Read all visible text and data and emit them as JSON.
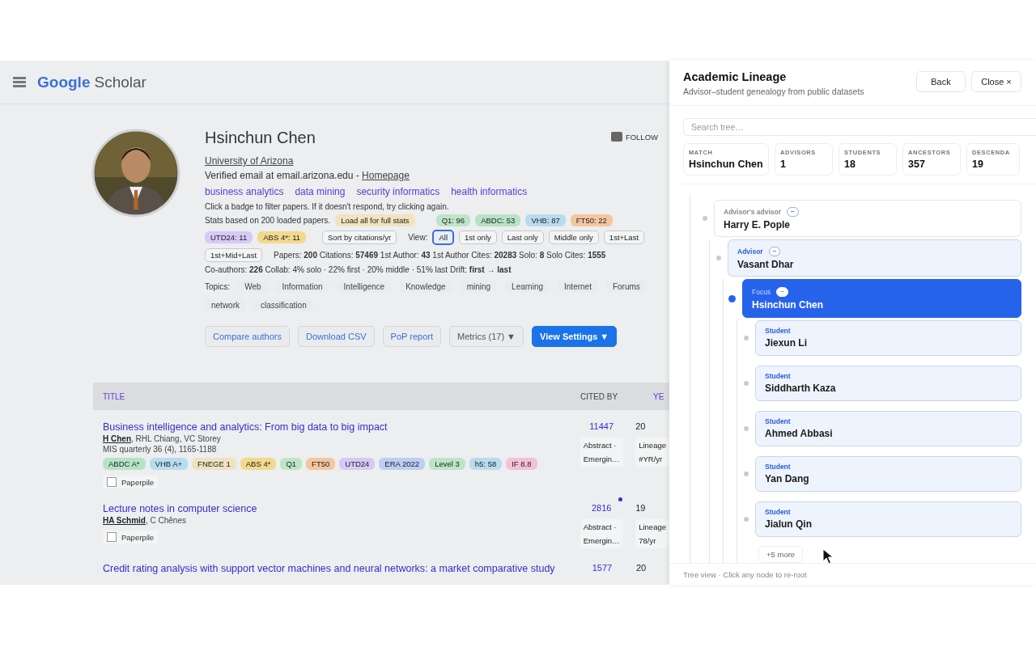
{
  "background_page": {
    "logo": {
      "first": "Google",
      "second": "Scholar"
    },
    "profile": {
      "name": "Hsinchun Chen",
      "affiliation": "University of Arizona",
      "email": "Verified email at email.arizona.edu - ",
      "homepage": "Homepage",
      "follow": "FOLLOW",
      "interests": [
        "business analytics",
        "data mining",
        "security informatics",
        "health informatics"
      ],
      "hint": "Click a badge to filter papers. If it doesn't respond, try clicking again.",
      "stats_note": "Stats based on 200 loaded papers.",
      "load_all": "Load all for full stats",
      "rank_badges": [
        {
          "label": "Q1: 96",
          "color": "#bde5c5"
        },
        {
          "label": "ABDC: 53",
          "color": "#b5e3c6"
        },
        {
          "label": "VHB: 87",
          "color": "#b8dcef"
        },
        {
          "label": "FT50: 22",
          "color": "#f4c6a0"
        },
        {
          "label": "UTD24: 11",
          "color": "#d7c9f6"
        },
        {
          "label": "ABS 4*: 11",
          "color": "#f3d98c"
        }
      ],
      "sort": "Sort by citations/yr",
      "view_label": "View:",
      "views": [
        {
          "label": "All",
          "selected": true
        },
        {
          "label": "1st only",
          "selected": false
        },
        {
          "label": "Last only",
          "selected": false
        },
        {
          "label": "Middle only",
          "selected": false
        },
        {
          "label": "1st+Last",
          "selected": false
        },
        {
          "label": "1st+Mid+Last",
          "selected": false
        }
      ],
      "metrics_line": "Papers: **200** Citations: **57469** 1st Author: **43** 1st Author Cites: **20283** Solo: **8** Solo Cites: **1555**",
      "coauthors_line": "Co-authors: **226** Collab: 4% solo · 22% first · 20% middle · 51% last Drift: **first → last**",
      "topics_label": "Topics:",
      "topics": [
        "Web",
        "Information",
        "Intelligence",
        "Knowledge",
        "mining",
        "Learning",
        "Internet",
        "Forums",
        "network",
        "classification"
      ],
      "actions": [
        {
          "label": "Compare authors",
          "kind": "outline"
        },
        {
          "label": "Download CSV",
          "kind": "outline"
        },
        {
          "label": "PoP report",
          "kind": "outline"
        },
        {
          "label": "Metrics (17) ▼",
          "kind": "plain"
        },
        {
          "label": "View Settings ▼",
          "kind": "primary"
        }
      ]
    },
    "table": {
      "columns": [
        "TITLE",
        "CITED BY",
        "YE"
      ],
      "rows": [
        {
          "title": "Business intelligence and analytics: From big data to big impact",
          "authors": "**H Chen**, RHL Chiang, VC Storey",
          "venue": "MIS quarterly 36 (4), 1165-1188",
          "badges": [
            {
              "label": "ABDC A*",
              "color": "#b5e3c6"
            },
            {
              "label": "VHB A+",
              "color": "#b8dcef"
            },
            {
              "label": "FNEGE 1",
              "color": "#efe2bf"
            },
            {
              "label": "ABS 4*",
              "color": "#f3d98c"
            },
            {
              "label": "Q1",
              "color": "#bde5c5"
            },
            {
              "label": "FT50",
              "color": "#f4c6a0"
            },
            {
              "label": "UTD24",
              "color": "#d7c9f6"
            },
            {
              "label": "ERA 2022",
              "color": "#bccff3"
            },
            {
              "label": "Level 3",
              "color": "#bde5c5"
            },
            {
              "label": "h5: 58",
              "color": "#b8dcef"
            },
            {
              "label": "IF 8.8",
              "color": "#f5c0d8"
            }
          ],
          "paperpile": "Paperpile",
          "paperpile_checked": false,
          "cited": "11447",
          "new": false,
          "year": "20",
          "actions": [
            "Abstract ·",
            "Emergin…"
          ],
          "lineage": [
            "Lineage",
            "#YR/yr"
          ]
        },
        {
          "title": "Lecture notes in computer science",
          "authors": "**HA Schmid**, C Chênes",
          "paperpile": "Paperpile",
          "paperpile_checked": false,
          "cited": "2816",
          "new": true,
          "year": "19",
          "actions": [
            "Abstract ·",
            "Emergin…"
          ],
          "lineage": [
            "Lineage",
            "78/yr"
          ]
        },
        {
          "title": "Credit rating analysis with support vector machines and neural networks: a market comparative study",
          "cited": "1577",
          "new": false,
          "year": "20"
        }
      ]
    }
  },
  "lineage_panel": {
    "title": "Academic Lineage",
    "subtitle": "Advisor–student genealogy from public datasets",
    "buttons": [
      "Back",
      "Close ×"
    ],
    "search": {
      "placeholder": "Search tree…"
    },
    "stats": [
      {
        "label": "MATCH",
        "value": "Hsinchun Chen"
      },
      {
        "label": "ADVISORS",
        "value": "1"
      },
      {
        "label": "STUDENTS",
        "value": "18"
      },
      {
        "label": "ANCESTORS",
        "value": "357"
      },
      {
        "label": "DESCENDA",
        "value": "19"
      }
    ],
    "tree": [
      {
        "kind": "ancestor",
        "role": "Advisor's advisor",
        "name": "Harry E. Pople",
        "toggle": "−",
        "children": [
          {
            "kind": "advisor",
            "role": "Advisor",
            "name": "Vasant Dhar",
            "toggle": "−",
            "children": [
              {
                "kind": "focus",
                "role": "Focus",
                "name": "Hsinchun Chen",
                "toggle": "−",
                "more": "+5 more",
                "children": [
                  {
                    "kind": "student",
                    "role": "Student",
                    "name": "Jiexun Li"
                  },
                  {
                    "kind": "student",
                    "role": "Student",
                    "name": "Siddharth Kaza"
                  },
                  {
                    "kind": "student",
                    "role": "Student",
                    "name": "Ahmed Abbasi"
                  },
                  {
                    "kind": "student",
                    "role": "Student",
                    "name": "Yan Dang"
                  },
                  {
                    "kind": "student",
                    "role": "Student",
                    "name": "Jialun Qin"
                  }
                ]
              }
            ]
          }
        ]
      }
    ],
    "footer": "Tree view · Click any node to re-root"
  }
}
